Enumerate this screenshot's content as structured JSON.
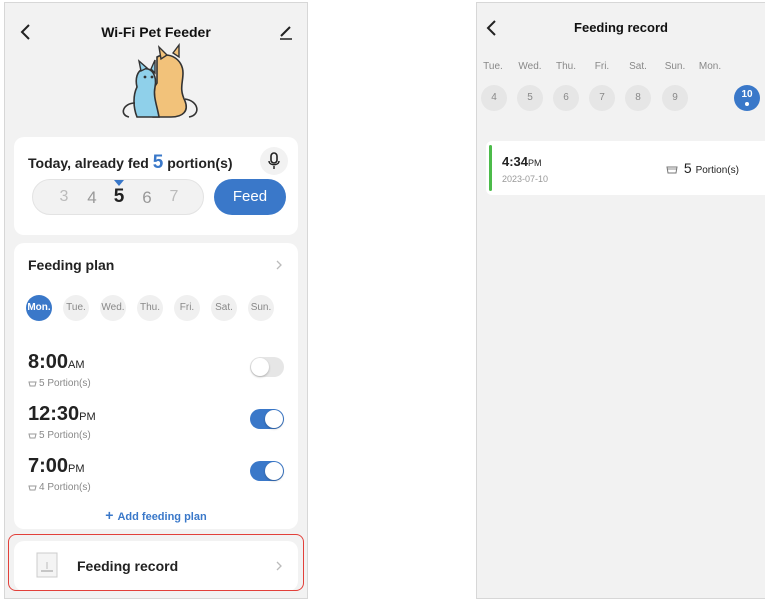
{
  "left_screen": {
    "title": "Wi-Fi Pet Feeder",
    "today": {
      "prefix": "Today, already fed",
      "count": "5",
      "suffix": "portion(s)",
      "picker": [
        "3",
        "4",
        "5",
        "6",
        "7"
      ],
      "selected_index": 2,
      "feed_label": "Feed"
    },
    "plan": {
      "title": "Feeding plan",
      "days": [
        "Mon.",
        "Tue.",
        "Wed.",
        "Thu.",
        "Fri.",
        "Sat.",
        "Sun."
      ],
      "active_day_index": 0,
      "items": [
        {
          "time": "8:00",
          "ampm": "AM",
          "portion": "5 Portion(s)",
          "enabled": false
        },
        {
          "time": "12:30",
          "ampm": "PM",
          "portion": "5 Portion(s)",
          "enabled": true
        },
        {
          "time": "7:00",
          "ampm": "PM",
          "portion": "4 Portion(s)",
          "enabled": true
        }
      ],
      "add_label": "Add feeding plan",
      "add_plus": "+"
    },
    "record_label": "Feeding record"
  },
  "right_screen": {
    "title": "Feeding record",
    "days": [
      {
        "name": "Tue.",
        "num": "4"
      },
      {
        "name": "Wed.",
        "num": "5"
      },
      {
        "name": "Thu.",
        "num": "6"
      },
      {
        "name": "Fri.",
        "num": "7"
      },
      {
        "name": "Sat.",
        "num": "8"
      },
      {
        "name": "Sun.",
        "num": "9"
      },
      {
        "name": "Mon.",
        "num": "10"
      }
    ],
    "active_day_index": 6,
    "record": {
      "time": "4:34",
      "ampm": "PM",
      "date": "2023-07-10",
      "count": "5",
      "unit": "Portion(s)"
    }
  },
  "colors": {
    "accent": "#3a78c9",
    "highlight": "#e2403a",
    "record_bar": "#4cbb4a",
    "background": "#f2f2f2"
  },
  "icons": [
    "back-arrow-icon",
    "edit-icon",
    "pet-illustration",
    "microphone-icon",
    "chevron-right-icon",
    "bowl-icon",
    "feeding-record-icon"
  ]
}
